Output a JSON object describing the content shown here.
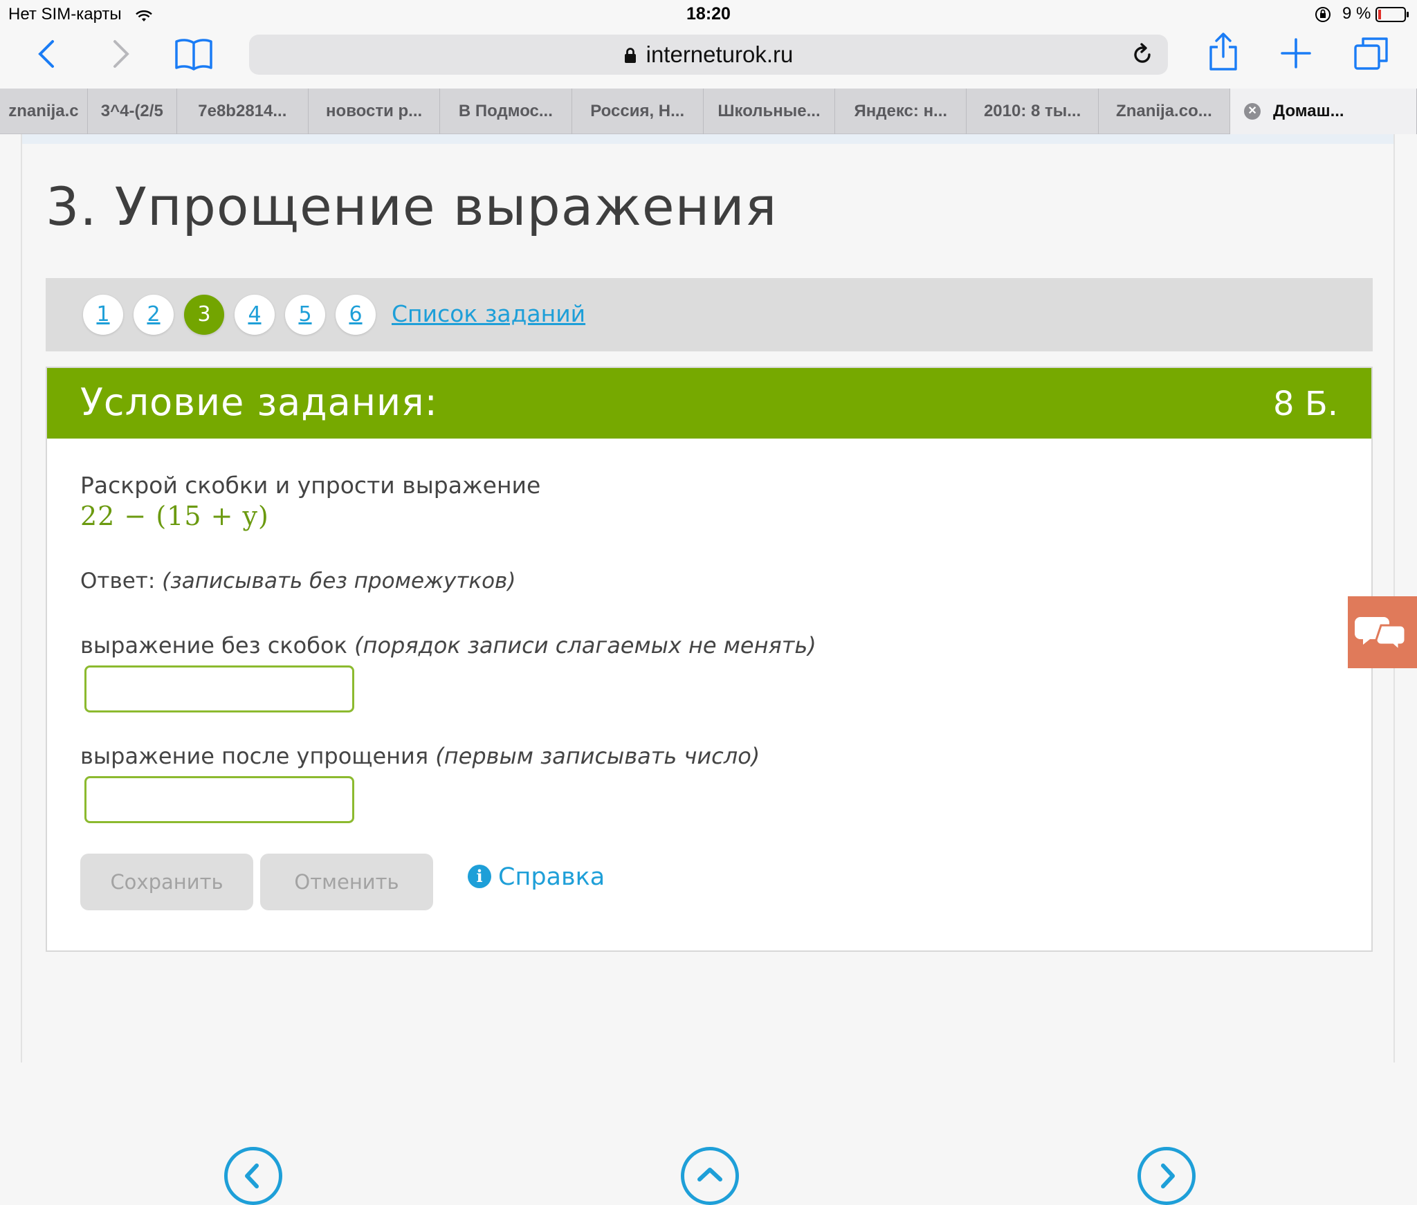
{
  "status_bar": {
    "carrier": "Нет SIM-карты",
    "time": "18:20",
    "battery": "9 %"
  },
  "browser": {
    "url": "interneturok.ru",
    "tabs": [
      {
        "label": "znanija.c"
      },
      {
        "label": "3^4-(2/5"
      },
      {
        "label": "7e8b2814..."
      },
      {
        "label": "новости р..."
      },
      {
        "label": "В Подмос..."
      },
      {
        "label": "Россия, Н..."
      },
      {
        "label": "Школьные..."
      },
      {
        "label": "Яндекс: н..."
      },
      {
        "label": "2010: 8 ты..."
      },
      {
        "label": "Znanija.co..."
      },
      {
        "label": "Домаш...",
        "active": true
      }
    ]
  },
  "page": {
    "title": "3. Упрощение выражения",
    "task_nav": {
      "numbers": [
        "1",
        "2",
        "3",
        "4",
        "5",
        "6"
      ],
      "current": "3",
      "list_link": "Список заданий"
    },
    "task": {
      "header_title": "Условие задания:",
      "score": "8 Б.",
      "question": "Раскрой скобки и упрости выражение",
      "expression": "22 − (15 + y)",
      "answer_label": "Ответ:",
      "answer_hint": "(записывать без промежутков)",
      "field1_label": "выражение без скобок",
      "field1_hint": "(порядок записи слагаемых не менять)",
      "field2_label": "выражение после упрощения",
      "field2_hint": "(первым записывать число)",
      "save_button": "Сохранить",
      "cancel_button": "Отменить",
      "help_link": "Справка"
    }
  },
  "colors": {
    "accent_green": "#76a900",
    "link_blue": "#1e9fd8",
    "chat_tab": "#e07a5a"
  }
}
